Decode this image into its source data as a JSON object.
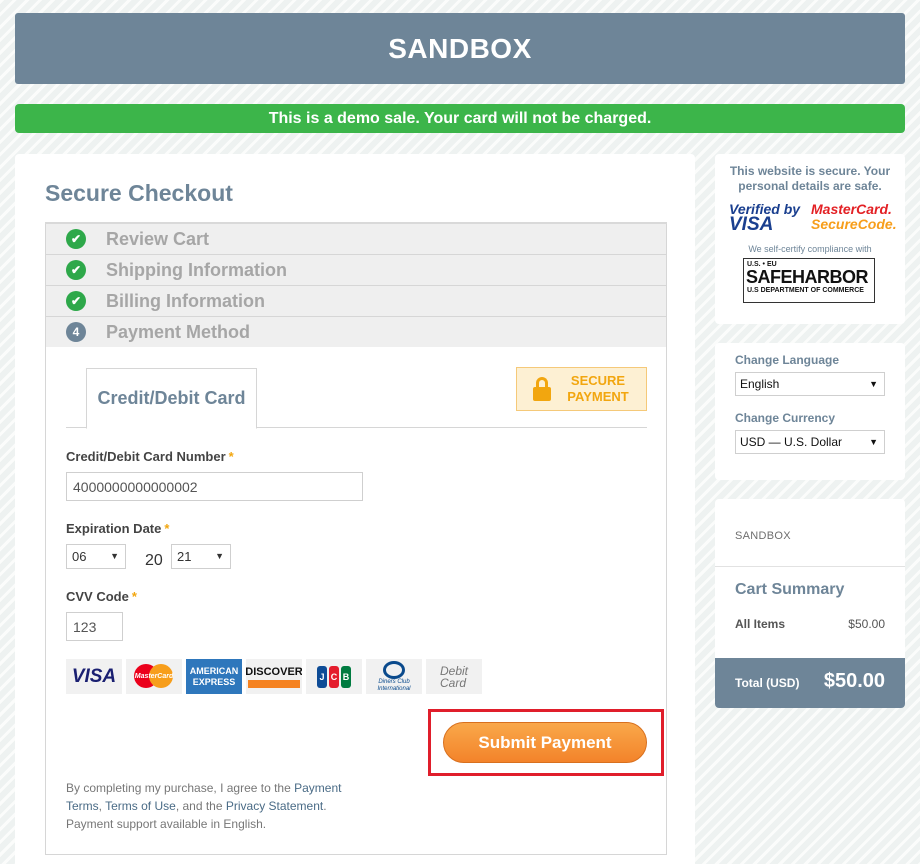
{
  "header": {
    "title": "SANDBOX"
  },
  "banner": {
    "text": "This is a demo sale. Your card will not be charged."
  },
  "checkout": {
    "title": "Secure Checkout",
    "steps": [
      {
        "label": "Review Cart",
        "status": "done"
      },
      {
        "label": "Shipping Information",
        "status": "done"
      },
      {
        "label": "Billing Information",
        "status": "done"
      },
      {
        "label": "Payment Method",
        "status": "current",
        "number": "4"
      }
    ]
  },
  "payment": {
    "tab_label": "Credit/Debit Card",
    "secure_badge": {
      "line1": "SECURE",
      "line2": "PAYMENT"
    },
    "card_number": {
      "label": "Credit/Debit Card Number",
      "required_mark": "*",
      "value": "4000000000000002"
    },
    "expiration": {
      "label": "Expiration Date",
      "required_mark": "*",
      "month": "06",
      "year_prefix": "20",
      "year": "21"
    },
    "cvv": {
      "label": "CVV Code",
      "required_mark": "*",
      "value": "123"
    },
    "card_logos": {
      "visa": "VISA",
      "mastercard": "MasterCard",
      "amex_line1": "AMERICAN",
      "amex_line2": "EXPRESS",
      "discover": "DISCOVER",
      "jcb": [
        "J",
        "C",
        "B"
      ],
      "diners_line1": "Diners Club",
      "diners_line2": "International",
      "debit_line1": "Debit",
      "debit_line2": "Card"
    },
    "submit_label": "Submit Payment",
    "legal": {
      "prefix": "By completing my purchase, I agree to the ",
      "link1": "Payment Terms",
      "sep1": ", ",
      "link2": "Terms of Use",
      "sep2": ", and the ",
      "link3": "Privacy Statement",
      "suffix": ".",
      "support": "Payment support available in English."
    }
  },
  "sidebar": {
    "secure_msg": "This website is secure. Your personal details are safe.",
    "verified_visa_line1": "Verified by",
    "verified_visa_line2": "VISA",
    "mc_securecode_line1": "MasterCard.",
    "mc_securecode_line2": "SecureCode.",
    "self_certify": "We self-certify compliance with",
    "safeharbor_top": "U.S. • EU",
    "safeharbor_mid": "SAFEHARBOR",
    "safeharbor_bottom": "U.S DEPARTMENT OF COMMERCE",
    "language_label": "Change Language",
    "language_value": "English",
    "currency_label": "Change Currency",
    "currency_value": "USD — U.S. Dollar",
    "cart": {
      "store": "SANDBOX",
      "title": "Cart Summary",
      "items_label": "All Items",
      "items_value": "$50.00",
      "total_label": "Total (USD)",
      "total_value": "$50.00"
    }
  },
  "colors": {
    "header_bg": "#6e8598",
    "banner_bg": "#3cb54a",
    "accent_orange": "#f3832a",
    "highlight_red": "#e01e2b"
  },
  "icons": {
    "step_done": "check-circle-icon",
    "lock": "lock-icon",
    "dropdown": "chevron-down-icon"
  }
}
